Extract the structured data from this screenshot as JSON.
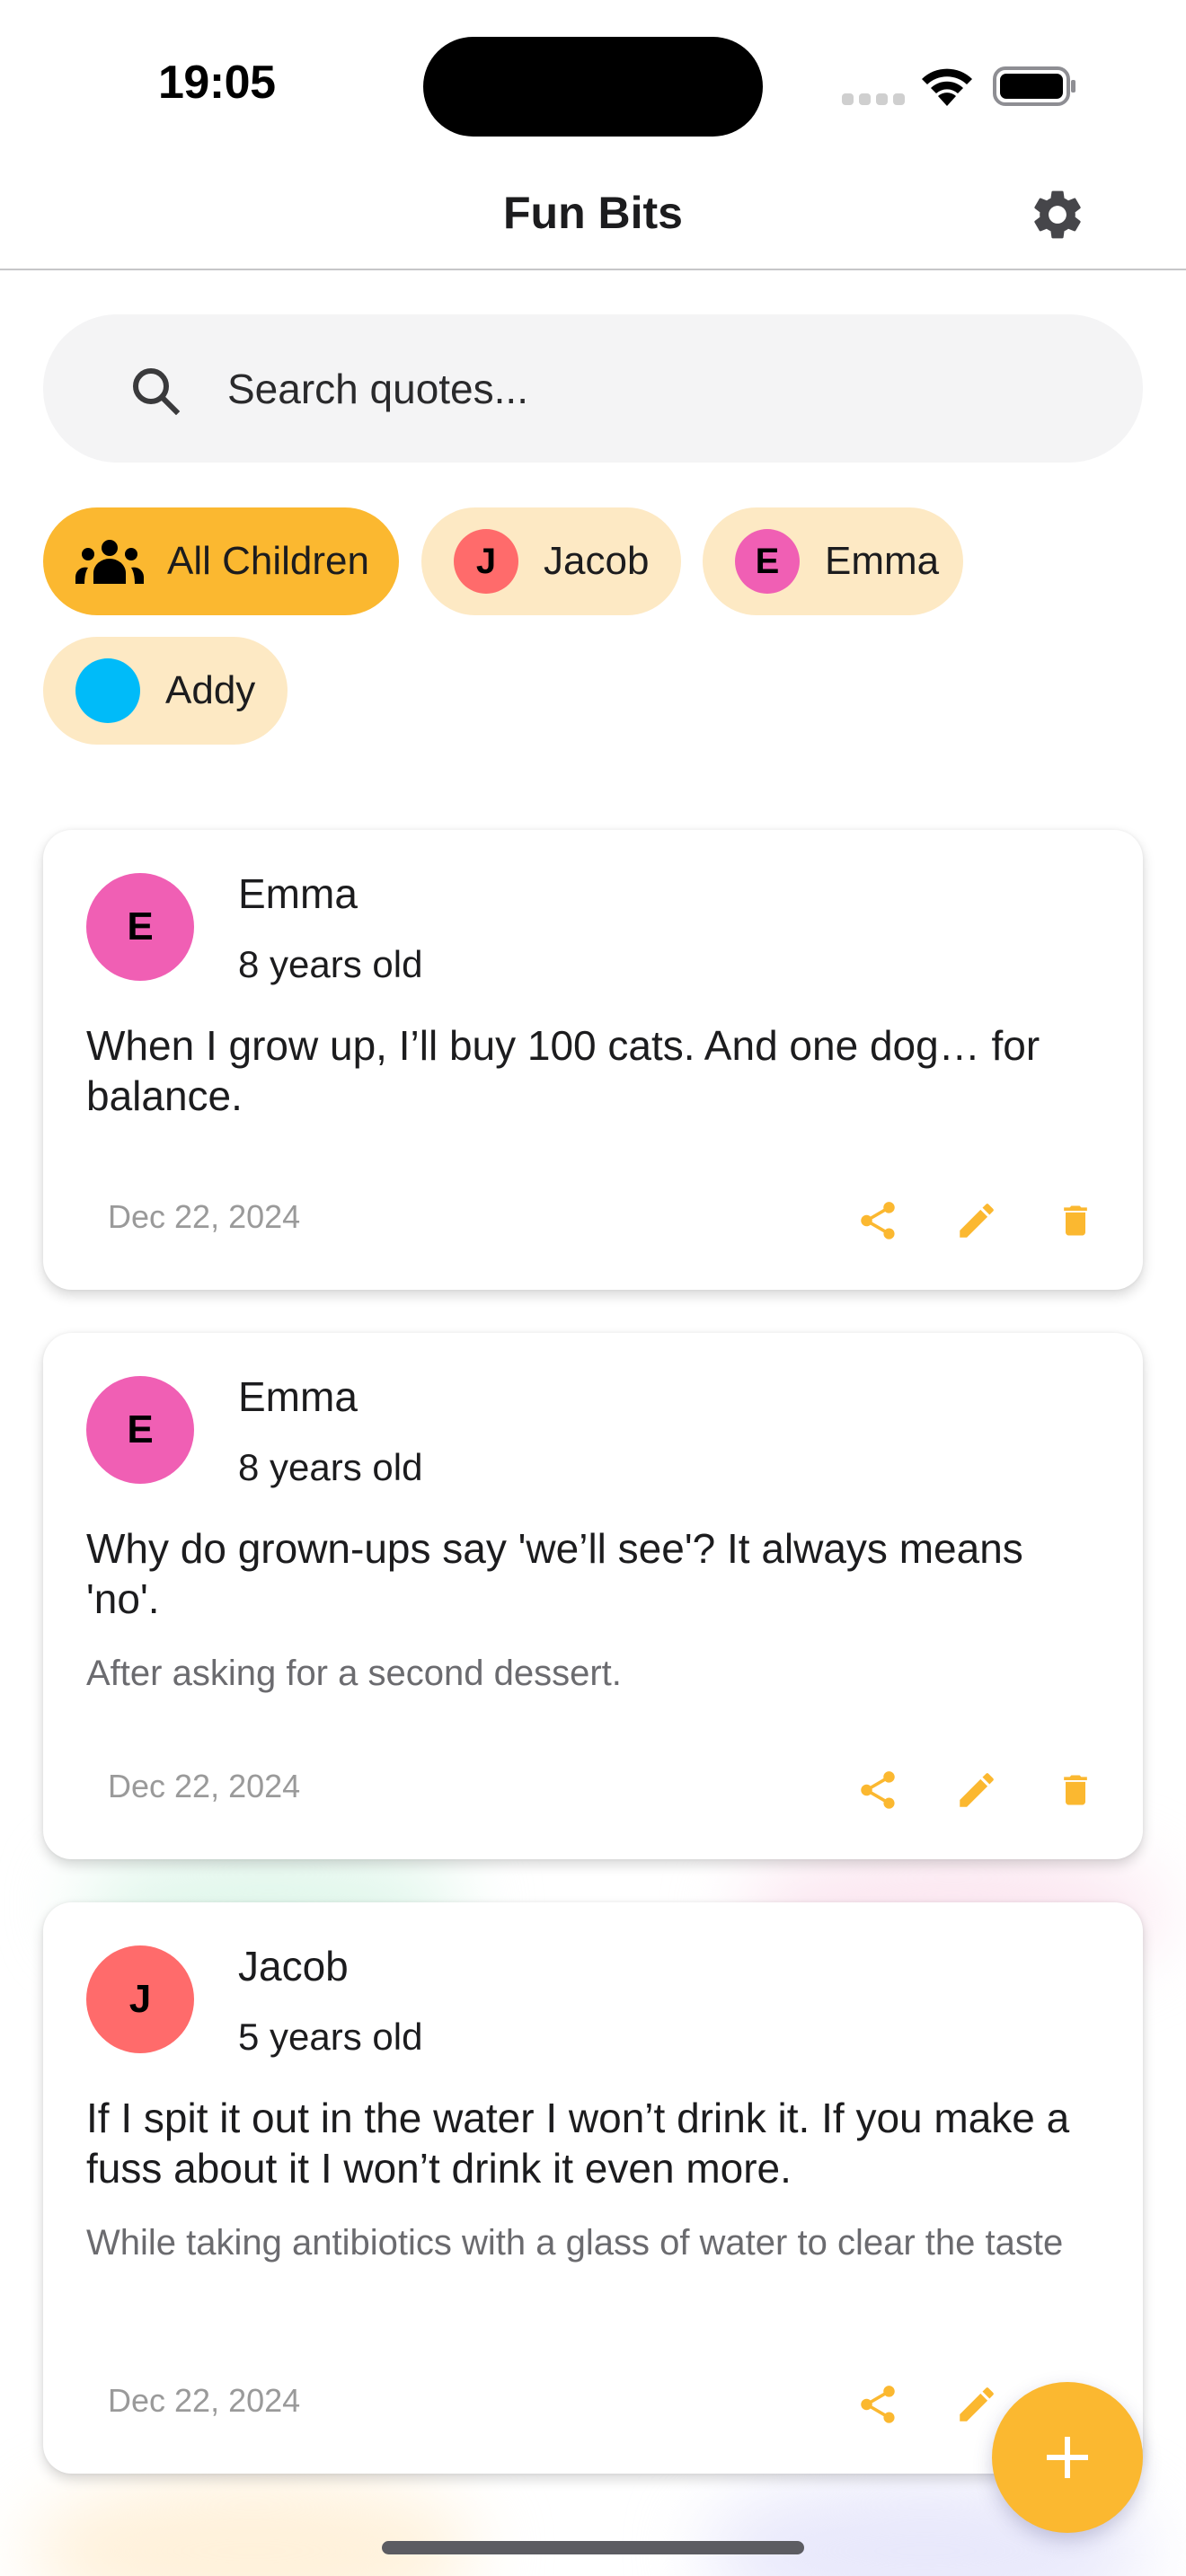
{
  "status_bar": {
    "time": "19:05",
    "icons": [
      "signal-dots-icon",
      "wifi-icon",
      "battery-icon"
    ]
  },
  "header": {
    "title": "Fun Bits",
    "settings_icon": "gear-icon"
  },
  "search": {
    "placeholder": "Search quotes...",
    "value": "",
    "icon": "search-icon"
  },
  "filters": [
    {
      "label": "All Children",
      "icon": "group-icon",
      "selected": true
    },
    {
      "label": "Jacob",
      "initial": "J",
      "color": "#ff6b6b",
      "selected": false
    },
    {
      "label": "Emma",
      "initial": "E",
      "color": "#f05fb4",
      "selected": false
    },
    {
      "label": "Addy",
      "initial": "",
      "color": "#00bbf9",
      "selected": false
    }
  ],
  "quotes": [
    {
      "child": "Emma",
      "initial": "E",
      "avatar_color": "#f05fb4",
      "age": "8 years old",
      "quote": "When I grow up, I’ll buy 100 cats. And one dog… for balance.",
      "context": "",
      "date": "Dec 22, 2024"
    },
    {
      "child": "Emma",
      "initial": "E",
      "avatar_color": "#f05fb4",
      "age": "8 years old",
      "quote": "Why do grown-ups say 'we’ll see'? It always means 'no'.",
      "context": "After asking for a second dessert.",
      "date": "Dec 22, 2024"
    },
    {
      "child": "Jacob",
      "initial": "J",
      "avatar_color": "#ff6b6b",
      "age": "5 years old",
      "quote": "If I spit it out in the water I won’t drink it. If you make a fuss about it I won’t drink it even more.",
      "context": "While taking antibiotics with a glass of water to clear the taste",
      "date": "Dec 22, 2024"
    }
  ],
  "card_actions": [
    "share-icon",
    "edit-icon",
    "delete-icon"
  ],
  "fab": {
    "icon": "plus-icon",
    "label": "Add quote"
  },
  "colors": {
    "accent": "#fbb830",
    "chip_bg": "#fde9c4",
    "search_bg": "#f4f4f5",
    "date_text": "#9a9a9a",
    "context_text": "#6b6b6f"
  }
}
